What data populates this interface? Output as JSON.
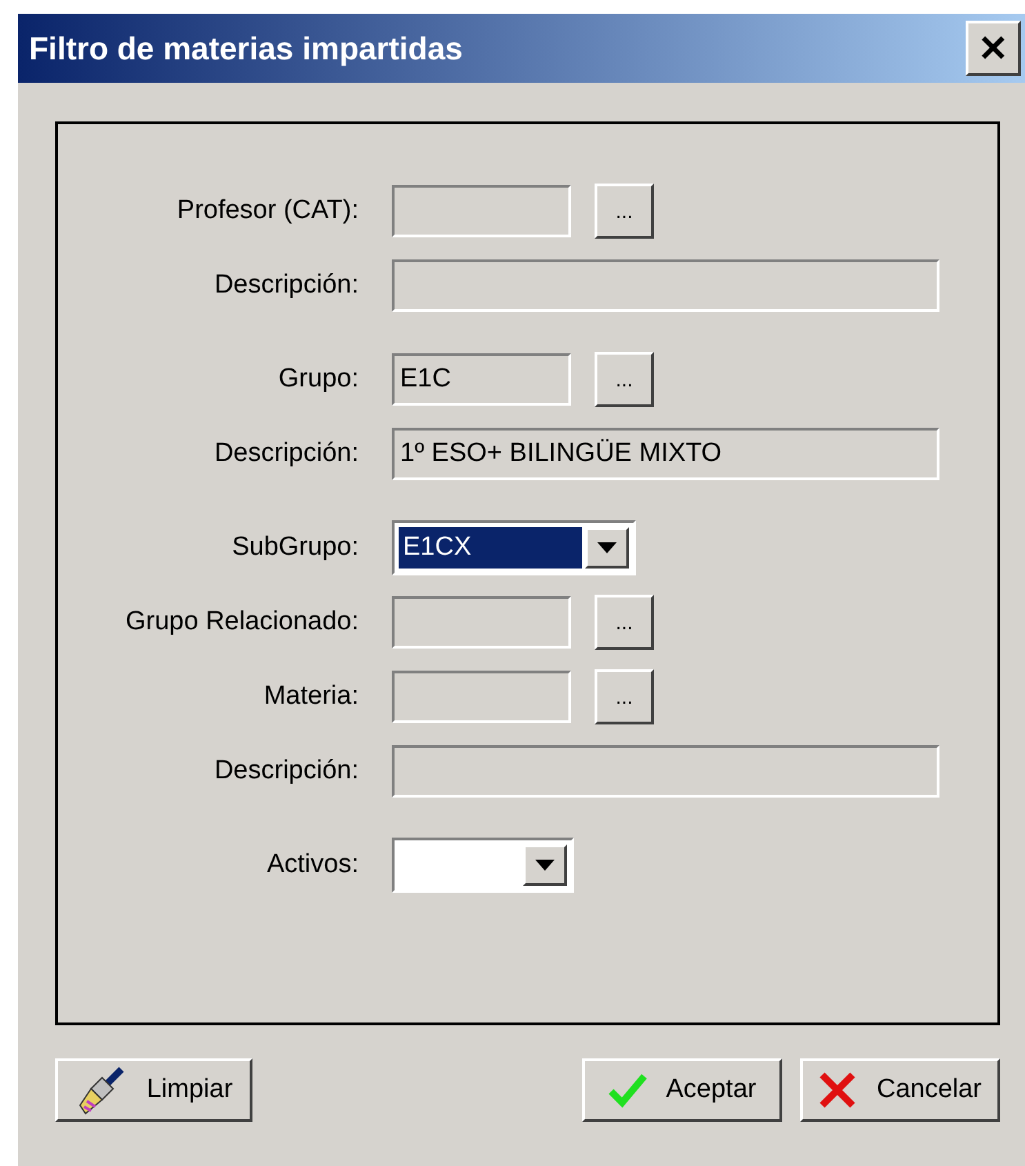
{
  "window": {
    "title": "Filtro de materias impartidas",
    "close_button": "✕"
  },
  "sections": [
    {
      "rows": [
        {
          "kind": "lookup",
          "label": "Profesor (CAT):",
          "button": "..."
        },
        {
          "kind": "text",
          "label": "Descripción:"
        }
      ]
    },
    {
      "rows": [
        {
          "kind": "lookup",
          "label": "Grupo:",
          "value": "E1C",
          "button": "..."
        },
        {
          "kind": "text",
          "label": "Descripción:",
          "value": "1º ESO+ BILINGÜE MIXTO"
        }
      ]
    },
    {
      "rows": [
        {
          "kind": "combo",
          "label": "SubGrupo:",
          "value": "E1CX",
          "highlighted": true
        },
        {
          "kind": "lookup",
          "label": "Grupo Relacionado:",
          "button": "..."
        },
        {
          "kind": "lookup",
          "label": "Materia:",
          "button": "..."
        },
        {
          "kind": "text",
          "label": "Descripción:"
        }
      ]
    },
    {
      "rows": [
        {
          "kind": "combo",
          "label": "Activos:",
          "highlighted": false
        }
      ]
    }
  ],
  "buttons": [
    {
      "label": "Limpiar"
    },
    {
      "label": "Aceptar"
    },
    {
      "label": "Cancelar"
    }
  ]
}
